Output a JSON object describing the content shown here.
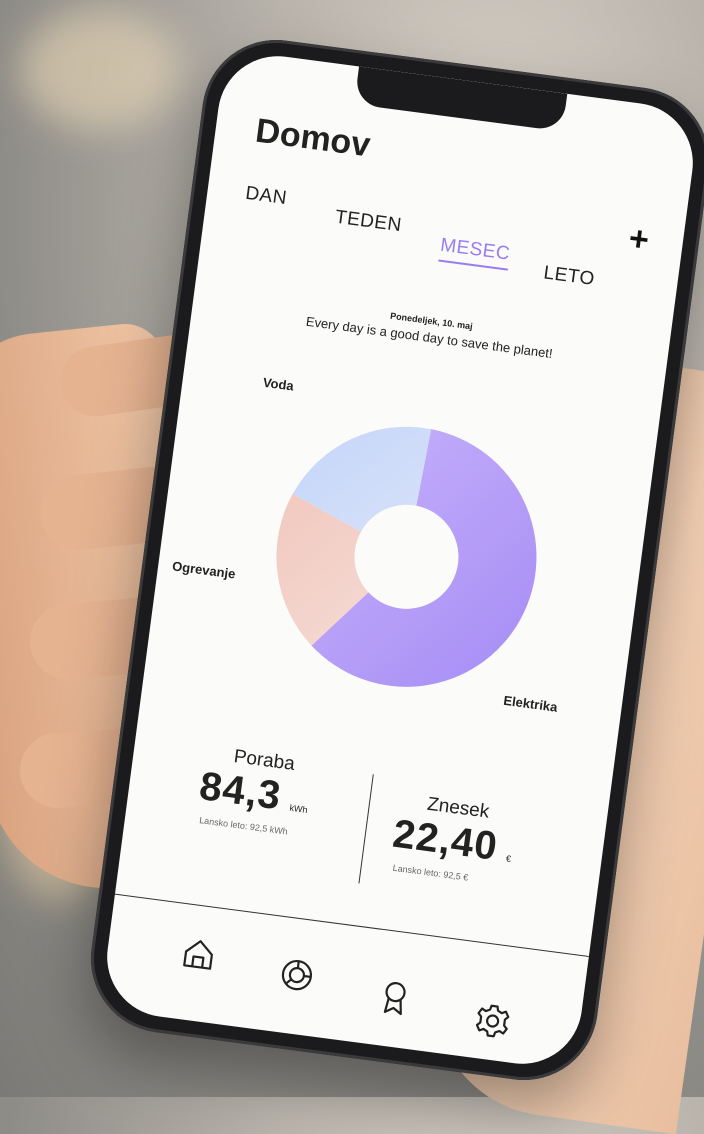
{
  "header": {
    "title": "Domov",
    "add_label": "+"
  },
  "tabs": [
    {
      "label": "DAN",
      "active": false
    },
    {
      "label": "TEDEN",
      "active": false
    },
    {
      "label": "MESEC",
      "active": true
    },
    {
      "label": "LETO",
      "active": false
    }
  ],
  "date_text": "Ponedeljek, 10. maj",
  "motto": "Every day is a good day to save the planet!",
  "chart_data": {
    "type": "pie",
    "categories": [
      "Elektrika",
      "Ogrevanje",
      "Voda"
    ],
    "values": [
      60,
      20,
      20
    ],
    "colors": [
      "#b9a2f7",
      "#f0c9c4",
      "#c9d8f8"
    ],
    "donut": true
  },
  "stats": {
    "poraba": {
      "label": "Poraba",
      "value": "84,3",
      "unit": "kWh",
      "previous": "Lansko leto: 92,5 kWh"
    },
    "znesek": {
      "label": "Znesek",
      "value": "22,40",
      "unit": "€",
      "previous": "Lansko leto: 92,5 €"
    }
  },
  "nav": {
    "items": [
      {
        "name": "home-icon"
      },
      {
        "name": "chart-donut-icon"
      },
      {
        "name": "award-icon"
      },
      {
        "name": "settings-icon"
      }
    ]
  },
  "colors": {
    "accent": "#9a7cf2",
    "background": "#fbfbf9"
  }
}
